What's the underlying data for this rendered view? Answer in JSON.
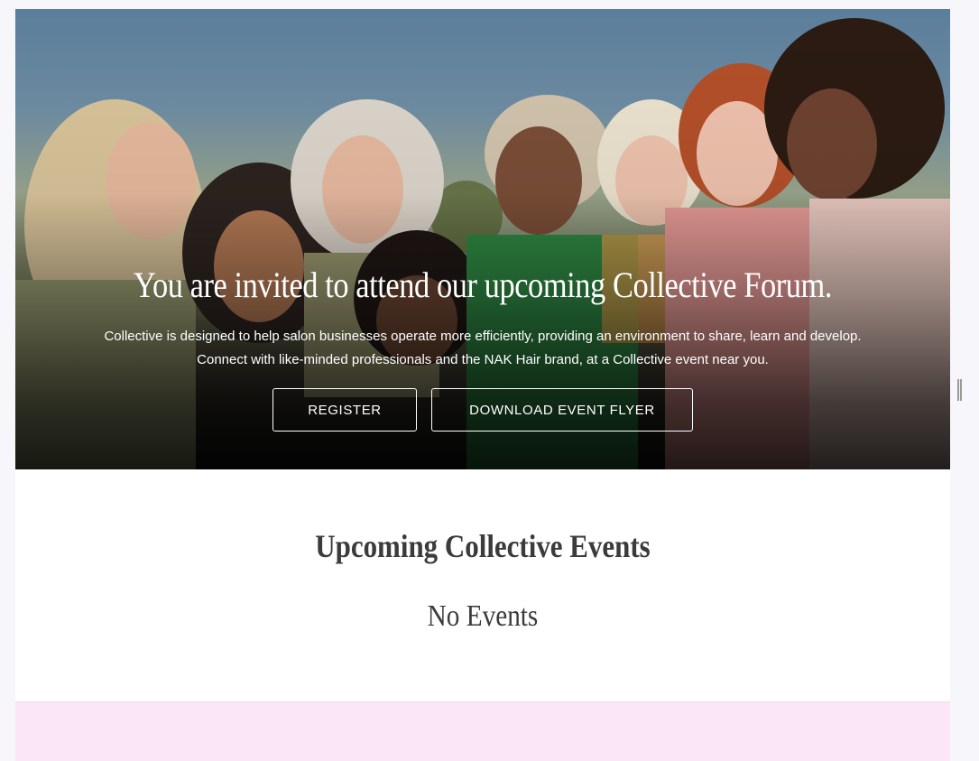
{
  "hero": {
    "title": "You are invited to attend our upcoming Collective Forum.",
    "description_line1": "Collective is designed to help salon businesses operate more efficiently, providing an environment to share, learn and develop.",
    "description_line2": "Connect with like-minded professionals and the NAK Hair brand, at a Collective event near you.",
    "register_label": "REGISTER",
    "flyer_label": "DOWNLOAD EVENT FLYER"
  },
  "events": {
    "heading": "Upcoming Collective Events",
    "empty_message": "No Events"
  },
  "colors": {
    "text_dark": "#3b3b3b",
    "pink_band": "#fae6f7",
    "button_border": "#ffffff"
  }
}
